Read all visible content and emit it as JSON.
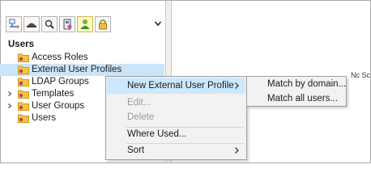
{
  "toolbar": {
    "buttons": [
      {
        "icon": "network-node-icon"
      },
      {
        "icon": "user-hat-icon"
      },
      {
        "icon": "search-key-icon"
      },
      {
        "icon": "user-card-icon"
      },
      {
        "icon": "user-group-icon",
        "active": true
      },
      {
        "icon": "lock-icon"
      }
    ],
    "dropdown_icon": "chevron-down-icon"
  },
  "section_label": "Users",
  "tree": [
    {
      "label": "Access Roles",
      "has_children": false,
      "selected": false
    },
    {
      "label": "External User Profiles",
      "has_children": false,
      "selected": true
    },
    {
      "label": "LDAP Groups",
      "has_children": false,
      "selected": false
    },
    {
      "label": "Templates",
      "has_children": true,
      "selected": false
    },
    {
      "label": "User Groups",
      "has_children": true,
      "selected": false
    },
    {
      "label": "Users",
      "has_children": false,
      "selected": false
    }
  ],
  "context_menu": {
    "items": [
      {
        "label": "New External User Profile",
        "enabled": true,
        "submenu": true,
        "highlighted": true
      },
      {
        "label": "Edit...",
        "enabled": false
      },
      {
        "label": "Delete",
        "enabled": false
      },
      {
        "label": "Where Used...",
        "enabled": true
      },
      {
        "label": "Sort",
        "enabled": true,
        "submenu": true
      }
    ]
  },
  "submenu": {
    "items": [
      {
        "label": "Match by domain..."
      },
      {
        "label": "Match all users..."
      }
    ]
  },
  "right_pane_text": "Nc Sc",
  "colors": {
    "selection": "#cce4f7",
    "menu_highlight": "#cce8ff",
    "menu_background": "#f2f2f2",
    "folder_yellow": "#f3c63e"
  }
}
